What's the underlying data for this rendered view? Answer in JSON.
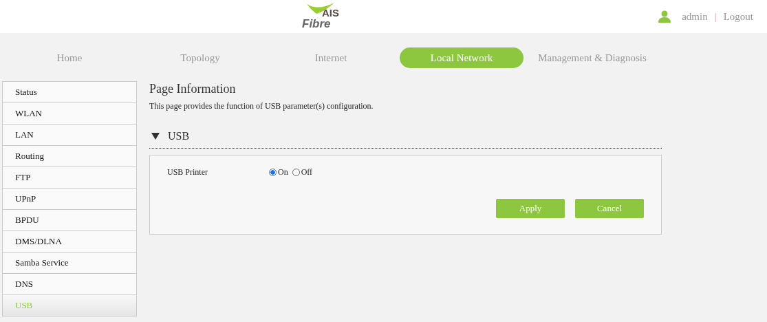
{
  "header": {
    "logo": {
      "brand": "AIS",
      "product": "Fibre"
    },
    "user": "admin",
    "separator": "|",
    "logout": "Logout"
  },
  "tabs": [
    {
      "label": "Home",
      "selected": false
    },
    {
      "label": "Topology",
      "selected": false
    },
    {
      "label": "Internet",
      "selected": false
    },
    {
      "label": "Local Network",
      "selected": true
    },
    {
      "label": "Management & Diagnosis",
      "selected": false
    }
  ],
  "sidebar": {
    "items": [
      {
        "label": "Status",
        "selected": false
      },
      {
        "label": "WLAN",
        "selected": false
      },
      {
        "label": "LAN",
        "selected": false
      },
      {
        "label": "Routing",
        "selected": false
      },
      {
        "label": "FTP",
        "selected": false
      },
      {
        "label": "UPnP",
        "selected": false
      },
      {
        "label": "BPDU",
        "selected": false
      },
      {
        "label": "DMS/DLNA",
        "selected": false
      },
      {
        "label": "Samba Service",
        "selected": false
      },
      {
        "label": "DNS",
        "selected": false
      },
      {
        "label": "USB",
        "selected": true
      }
    ]
  },
  "page": {
    "title": "Page Information",
    "description": "This page provides the function of USB parameter(s) configuration.",
    "section": {
      "title": "USB",
      "expanded": true,
      "field": {
        "label": "USB Printer",
        "options": [
          {
            "label": "On",
            "selected": true
          },
          {
            "label": "Off",
            "selected": false
          }
        ]
      },
      "buttons": [
        "Apply",
        "Cancel"
      ]
    }
  }
}
